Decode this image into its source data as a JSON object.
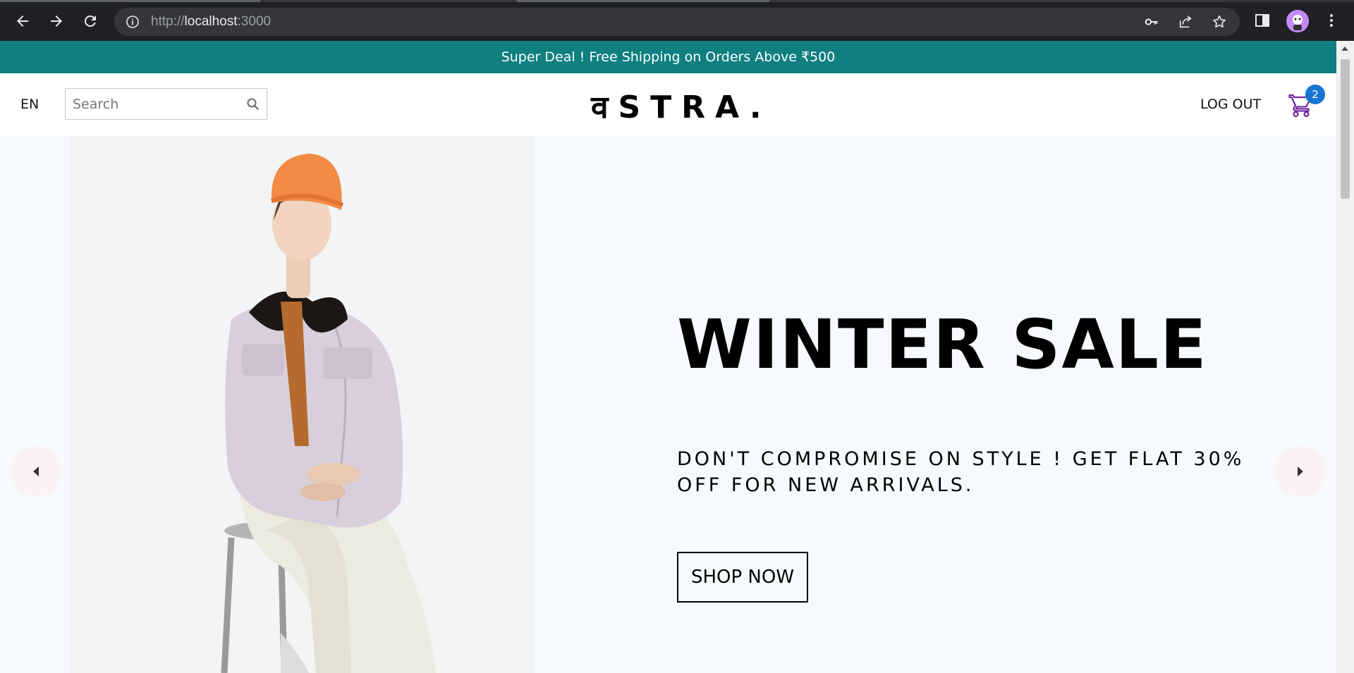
{
  "browser": {
    "url_scheme": "http://",
    "url_host": "localhost",
    "url_port": ":3000"
  },
  "announcement": {
    "text": "Super Deal ! Free Shipping on Orders Above ₹500",
    "background": "#0f7f7f"
  },
  "navbar": {
    "language": "EN",
    "search_placeholder": "Search",
    "logo": "वSTRA.",
    "logout_label": "LOG OUT",
    "cart_count": "2",
    "cart_icon_color": "#6a1b9a",
    "badge_color": "#1976d2"
  },
  "slide": {
    "title": "WINTER SALE",
    "description": "DON'T COMPROMISE ON STYLE ! GET FLAT 30% OFF FOR NEW ARRIVALS.",
    "button_label": "SHOP NOW",
    "image": "man-in-beanie-and-jacket-on-stool"
  },
  "icons": {
    "back": "arrow-left-icon",
    "forward": "arrow-right-icon",
    "reload": "reload-icon",
    "info": "info-icon",
    "key": "key-icon",
    "share": "share-icon",
    "star": "star-icon",
    "sidepanel": "side-panel-icon",
    "menu": "kebab-menu-icon",
    "search": "search-icon",
    "cart": "shopping-cart-icon",
    "slide_prev": "arrow-left-icon",
    "slide_next": "arrow-right-icon"
  }
}
